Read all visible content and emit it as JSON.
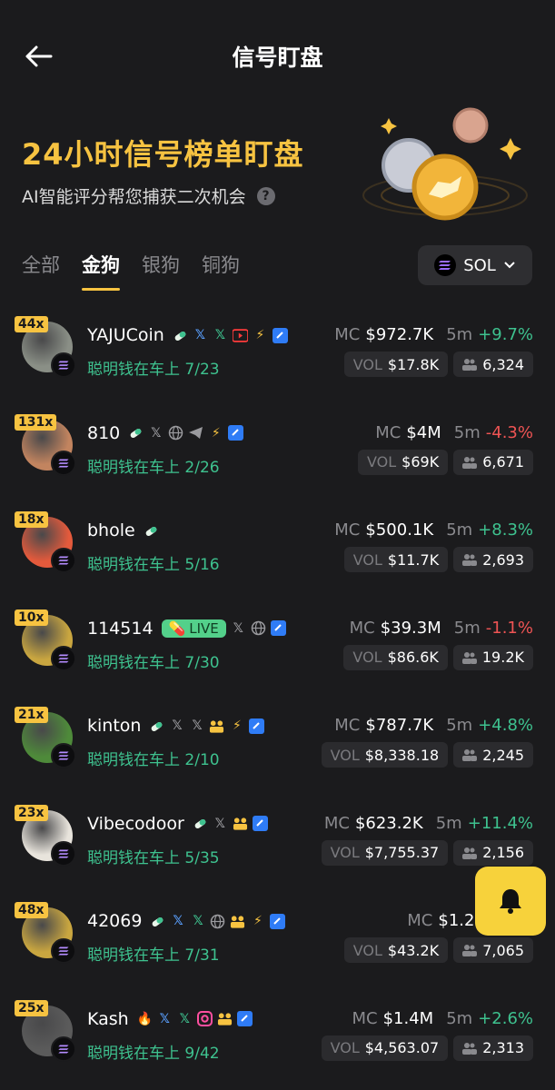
{
  "header": {
    "title": "信号盯盘",
    "back_icon": "arrow-left-icon"
  },
  "hero": {
    "title": "24小时信号榜单盯盘",
    "subtitle": "AI智能评分帮您捕获二次机会",
    "help_glyph": "?"
  },
  "tabs": [
    {
      "label": "全部",
      "active": false
    },
    {
      "label": "金狗",
      "active": true
    },
    {
      "label": "银狗",
      "active": false
    },
    {
      "label": "铜狗",
      "active": false
    }
  ],
  "chain_selector": {
    "label": "SOL"
  },
  "labels": {
    "mc": "MC",
    "vol": "VOL",
    "timeframe": "5m"
  },
  "colors": {
    "accent_gold": "#f7c341",
    "green": "#3ec28f",
    "red": "#ef5454",
    "bell_yellow": "#f7d23b"
  },
  "tokens": [
    {
      "name": "YAJUCoin",
      "multiplier": "44x",
      "smart_money": "聪明钱在车上 7/23",
      "mc": "$972.7K",
      "change": "+9.7%",
      "dir": "up",
      "vol": "$17.8K",
      "holders": "6,324",
      "icons": [
        "pill-icon",
        "x-blue-icon",
        "x-green-icon",
        "youtube-icon",
        "lightning-icon",
        "chat-icon"
      ]
    },
    {
      "name": "810",
      "multiplier": "131x",
      "smart_money": "聪明钱在车上 2/26",
      "mc": "$4M",
      "change": "-4.3%",
      "dir": "down",
      "vol": "$69K",
      "holders": "6,671",
      "icons": [
        "pill-icon",
        "x-gray-icon",
        "globe-icon",
        "telegram-icon",
        "lightning-icon",
        "chat-icon"
      ]
    },
    {
      "name": "bhole",
      "multiplier": "18x",
      "smart_money": "聪明钱在车上 5/16",
      "mc": "$500.1K",
      "change": "+8.3%",
      "dir": "up",
      "vol": "$11.7K",
      "holders": "2,693",
      "icons": [
        "pill-icon"
      ]
    },
    {
      "name": "114514",
      "multiplier": "10x",
      "smart_money": "聪明钱在车上 7/30",
      "mc": "$39.3M",
      "change": "-1.1%",
      "dir": "down",
      "vol": "$86.6K",
      "holders": "19.2K",
      "live": "LIVE",
      "icons": [
        "x-gray-icon",
        "globe-icon",
        "chat-icon"
      ]
    },
    {
      "name": "kinton",
      "multiplier": "21x",
      "smart_money": "聪明钱在车上 2/10",
      "mc": "$787.7K",
      "change": "+4.8%",
      "dir": "up",
      "vol": "$8,338.18",
      "holders": "2,245",
      "icons": [
        "pill-icon",
        "x-gray-icon",
        "x-gray-icon",
        "users-icon",
        "lightning-icon",
        "chat-icon"
      ]
    },
    {
      "name": "Vibecodoor",
      "multiplier": "23x",
      "smart_money": "聪明钱在车上 5/35",
      "mc": "$623.2K",
      "change": "+11.4%",
      "dir": "up",
      "vol": "$7,755.37",
      "holders": "2,156",
      "icons": [
        "pill-icon",
        "x-gray-icon",
        "users-icon",
        "chat-icon"
      ]
    },
    {
      "name": "42069",
      "multiplier": "48x",
      "smart_money": "聪明钱在车上 7/31",
      "mc": "$1.2M",
      "change": "",
      "dir": "up",
      "vol": "$43.2K",
      "holders": "7,065",
      "icons": [
        "pill-icon",
        "x-blue-icon",
        "x-green-icon",
        "globe-icon",
        "users-icon",
        "lightning-icon",
        "chat-icon"
      ]
    },
    {
      "name": "Kash",
      "multiplier": "25x",
      "smart_money": "聪明钱在车上 9/42",
      "mc": "$1.4M",
      "change": "+2.6%",
      "dir": "up",
      "vol": "$4,563.07",
      "holders": "2,313",
      "icons": [
        "fire-icon",
        "x-blue-icon",
        "x-green-icon",
        "instagram-icon",
        "users-icon",
        "chat-icon"
      ]
    }
  ],
  "fab": {
    "icon": "bell-icon"
  }
}
